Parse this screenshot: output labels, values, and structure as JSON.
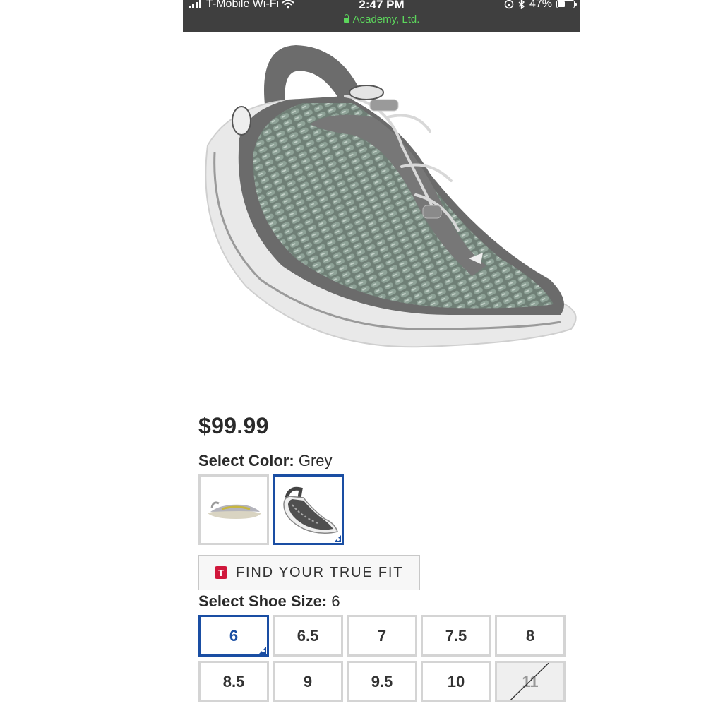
{
  "status_bar": {
    "carrier": "T-Mobile Wi-Fi",
    "time": "2:47 PM",
    "battery": "47%",
    "battery_level": 0.47,
    "site": "Academy, Ltd."
  },
  "product": {
    "price": "$99.99",
    "image": "sandal-grey-icon"
  },
  "color_selector": {
    "label": "Select Color:",
    "value": "Grey",
    "swatches": [
      {
        "name": "light-sandal-swatch",
        "selected": false
      },
      {
        "name": "grey-sandal-swatch",
        "selected": true
      }
    ]
  },
  "true_fit": {
    "icon_letter": "T",
    "label": "FIND YOUR TRUE FIT"
  },
  "size_selector": {
    "label": "Select Shoe Size:",
    "value": "6",
    "sizes": [
      {
        "label": "6",
        "selected": true,
        "available": true
      },
      {
        "label": "6.5",
        "selected": false,
        "available": true
      },
      {
        "label": "7",
        "selected": false,
        "available": true
      },
      {
        "label": "7.5",
        "selected": false,
        "available": true
      },
      {
        "label": "8",
        "selected": false,
        "available": true
      },
      {
        "label": "8.5",
        "selected": false,
        "available": true
      },
      {
        "label": "9",
        "selected": false,
        "available": true
      },
      {
        "label": "9.5",
        "selected": false,
        "available": true
      },
      {
        "label": "10",
        "selected": false,
        "available": true
      },
      {
        "label": "11",
        "selected": false,
        "available": false
      }
    ]
  },
  "colors": {
    "accent": "#1a4ea3",
    "status_bar_bg": "#3f3f3f",
    "secure_green": "#5cd65c",
    "truefit_red": "#d0173b"
  }
}
